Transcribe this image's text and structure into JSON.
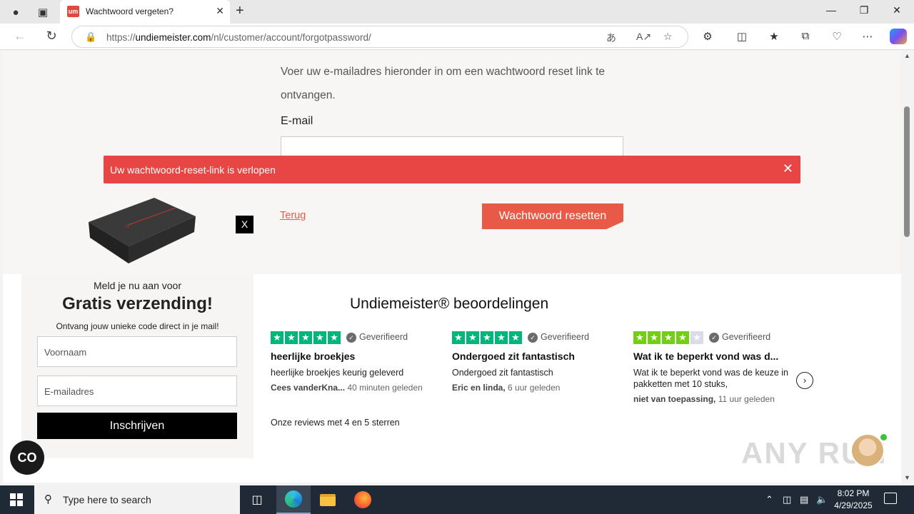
{
  "browser": {
    "tab_title": "Wachtwoord vergeten?",
    "tab_favicon_text": "um",
    "url_prefix": "https://",
    "url_domain": "undiemeister.com",
    "url_path": "/nl/customer/account/forgotpassword/",
    "icons": {
      "profile": "profile-icon",
      "tabs": "tab-actions-icon",
      "back": "back-arrow-icon",
      "refresh": "refresh-icon",
      "lock": "lock-icon",
      "translate": "translate-icon",
      "read_aloud": "read-aloud-icon",
      "favorite": "star-icon",
      "extensions": "extensions-icon",
      "split": "split-screen-icon",
      "favorites": "favorites-icon",
      "collections": "collections-icon",
      "performance": "heart-pulse-icon",
      "more": "more-icon",
      "copilot": "copilot-icon"
    }
  },
  "page": {
    "intro_text": "Voer uw e-mailadres hieronder in om een wachtwoord reset link te ontvangen.",
    "email_label": "E-mail",
    "email_value": "",
    "alert_message": "Uw wachtwoord-reset-link is verlopen",
    "alert_color": "#e84545",
    "back_link": "Terug",
    "reset_button": "Wachtwoord resetten",
    "accent_color": "#e85a47"
  },
  "popup": {
    "close_label": "X",
    "line1": "Meld je nu aan voor",
    "line2": "Gratis verzending!",
    "line3": "Ontvang jouw unieke code direct in je mail!",
    "first_name_placeholder": "Voornaam",
    "email_placeholder": "E-mailadres",
    "subscribe_button": "Inschrijven"
  },
  "reviews": {
    "title": "Undiemeister® beoordelingen",
    "verified_label": "Geverifieerd",
    "items": [
      {
        "rating": 5,
        "headline": "heerlijke broekjes",
        "body": "heerlijke broekjes keurig geleverd",
        "author": "Cees vanderKna...",
        "time": "40 minuten geleden"
      },
      {
        "rating": 5,
        "headline": "Ondergoed zit fantastisch",
        "body": "Ondergoed zit fantastisch",
        "author": "Eric en linda,",
        "time": "6 uur geleden"
      },
      {
        "rating": 4,
        "headline": "Wat ik te beperkt vond was d...",
        "body": "Wat ik te beperkt vond was de keuze in pakketten met 10 stuks,",
        "author": "niet van toepassing,",
        "time": "11 uur geleden"
      }
    ],
    "footer": "Onze reviews met 4 en 5 sterren",
    "star_color": "#00b67a"
  },
  "widgets": {
    "chat_label": "CO",
    "watermark": "ANY RUN"
  },
  "taskbar": {
    "search_placeholder": "Type here to search",
    "time": "8:02 PM",
    "date": "4/29/2025"
  }
}
